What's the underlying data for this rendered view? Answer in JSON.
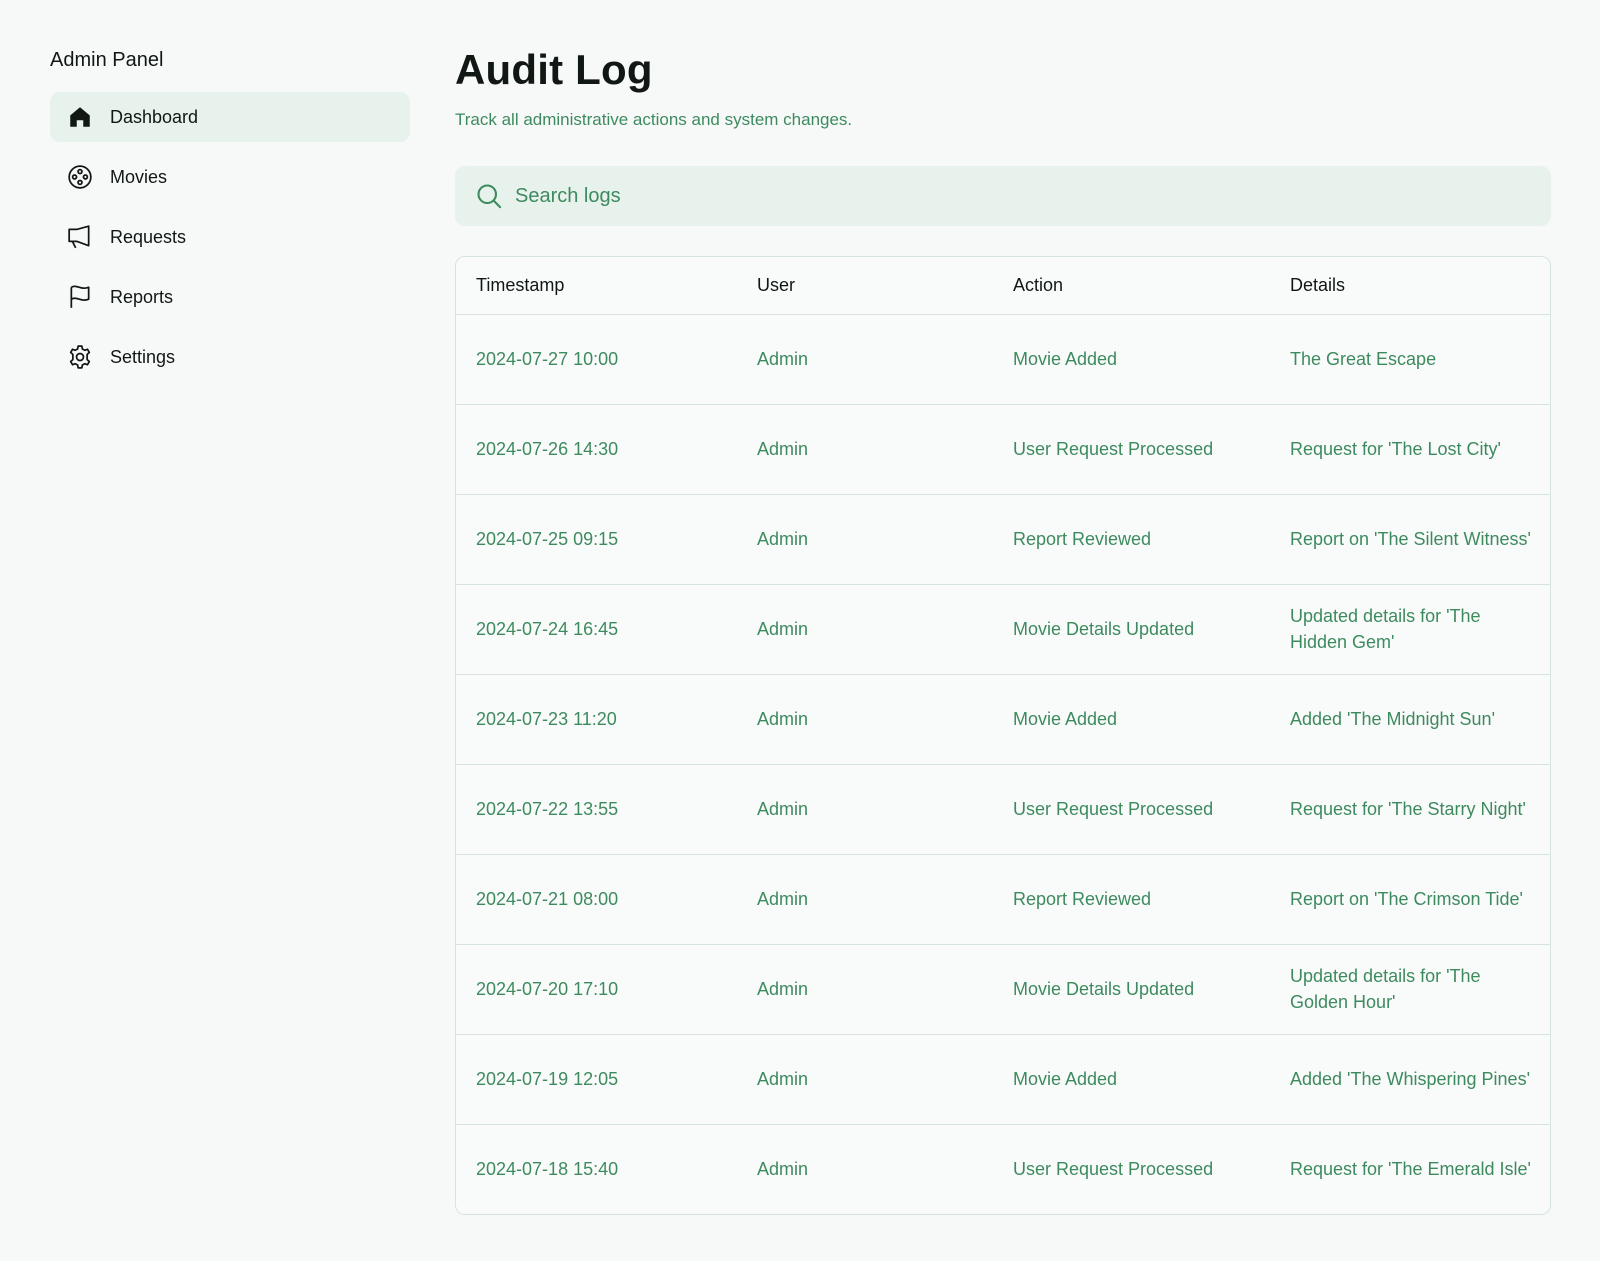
{
  "sidebar": {
    "title": "Admin Panel",
    "items": [
      {
        "label": "Dashboard",
        "icon": "house-icon",
        "active": true
      },
      {
        "label": "Movies",
        "icon": "film-reel-icon",
        "active": false
      },
      {
        "label": "Requests",
        "icon": "megaphone-icon",
        "active": false
      },
      {
        "label": "Reports",
        "icon": "flag-icon",
        "active": false
      },
      {
        "label": "Settings",
        "icon": "gear-icon",
        "active": false
      }
    ]
  },
  "main": {
    "title": "Audit Log",
    "subtitle": "Track all administrative actions and system changes.",
    "search": {
      "placeholder": "Search logs",
      "value": ""
    },
    "table": {
      "headers": [
        "Timestamp",
        "User",
        "Action",
        "Details"
      ],
      "rows": [
        {
          "timestamp": "2024-07-27 10:00",
          "user": "Admin",
          "action": "Movie Added",
          "details": "The Great Escape"
        },
        {
          "timestamp": "2024-07-26 14:30",
          "user": "Admin",
          "action": "User Request Processed",
          "details": "Request for 'The Lost City'"
        },
        {
          "timestamp": "2024-07-25 09:15",
          "user": "Admin",
          "action": "Report Reviewed",
          "details": "Report on 'The Silent Witness'"
        },
        {
          "timestamp": "2024-07-24 16:45",
          "user": "Admin",
          "action": "Movie Details Updated",
          "details": "Updated details for 'The Hidden Gem'"
        },
        {
          "timestamp": "2024-07-23 11:20",
          "user": "Admin",
          "action": "Movie Added",
          "details": "Added 'The Midnight Sun'"
        },
        {
          "timestamp": "2024-07-22 13:55",
          "user": "Admin",
          "action": "User Request Processed",
          "details": "Request for 'The Starry Night'"
        },
        {
          "timestamp": "2024-07-21 08:00",
          "user": "Admin",
          "action": "Report Reviewed",
          "details": "Report on 'The Crimson Tide'"
        },
        {
          "timestamp": "2024-07-20 17:10",
          "user": "Admin",
          "action": "Movie Details Updated",
          "details": "Updated details for 'The Golden Hour'"
        },
        {
          "timestamp": "2024-07-19 12:05",
          "user": "Admin",
          "action": "Movie Added",
          "details": "Added 'The Whispering Pines'"
        },
        {
          "timestamp": "2024-07-18 15:40",
          "user": "Admin",
          "action": "User Request Processed",
          "details": "Request for 'The Emerald Isle'"
        }
      ]
    }
  },
  "colors": {
    "background": "#f7f9f8",
    "accent_text": "#3e8a5f",
    "active_bg": "#e8f2ec",
    "border": "#d6e4dc",
    "text": "#111814"
  }
}
